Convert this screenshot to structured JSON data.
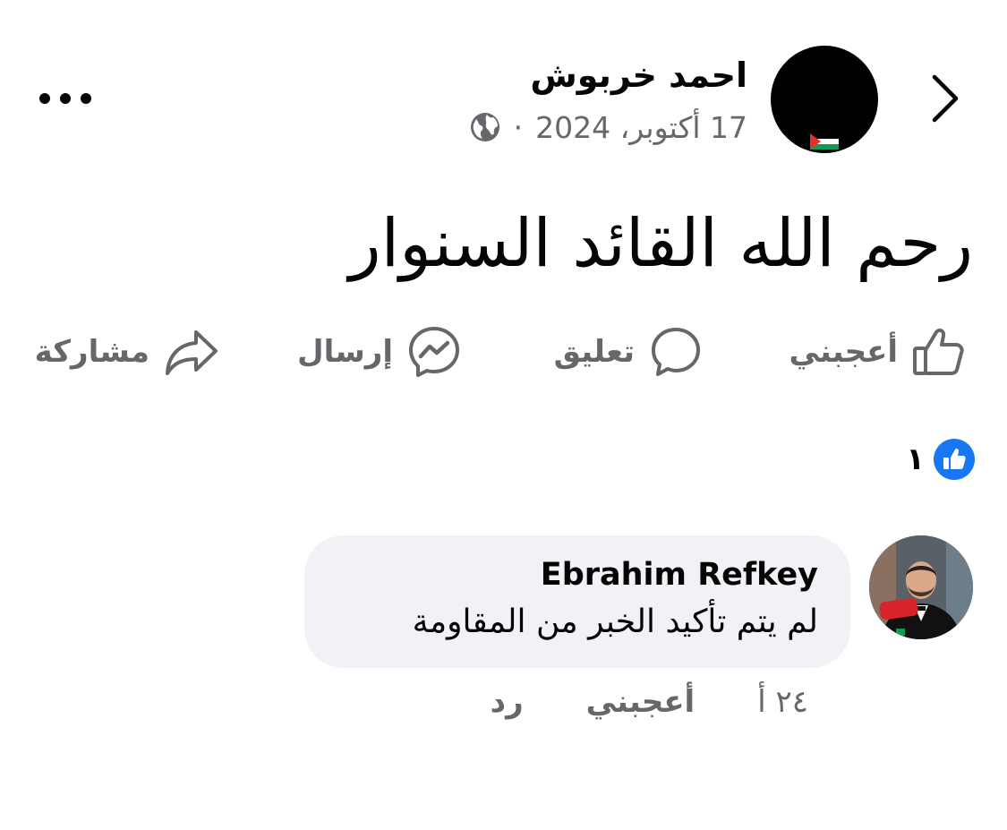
{
  "header": {
    "back_icon": "chevron-right-icon",
    "more_icon": "more-horizontal-icon",
    "author_name": "احمد خربوش",
    "post_date": "17 أكتوبر، 2024",
    "separator": "·",
    "privacy_icon": "globe-icon"
  },
  "post": {
    "text": "رحم الله القائد السنوار"
  },
  "actions": [
    {
      "label": "أعجبني",
      "icon": "thumbs-up-icon"
    },
    {
      "label": "تعليق",
      "icon": "comment-icon"
    },
    {
      "label": "إرسال",
      "icon": "messenger-icon"
    },
    {
      "label": "مشاركة",
      "icon": "share-icon"
    }
  ],
  "reactions": {
    "count": "١",
    "icon": "like-reaction-icon"
  },
  "comments": [
    {
      "author": "Ebrahim Refkey",
      "text": "لم يتم تأكيد الخبر من المقاومة",
      "time": "٢٤ أ",
      "like_label": "أعجبني",
      "reply_label": "رد"
    }
  ],
  "colors": {
    "text_primary": "#050505",
    "text_secondary": "#65676b",
    "accent": "#1877f2",
    "bubble": "#f0f2f5"
  }
}
